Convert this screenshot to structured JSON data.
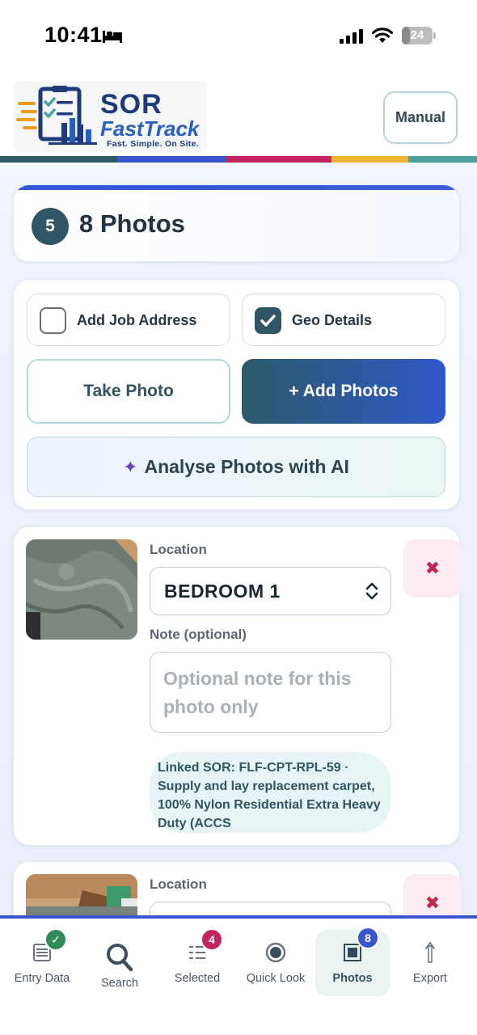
{
  "status_bar": {
    "time": "10:41",
    "battery_level": "24"
  },
  "header": {
    "logo": {
      "title": "SOR",
      "subtitle": "FastTrack",
      "tagline": "Fast. Simple. On Site."
    },
    "manual_label": "Manual",
    "strip_colors": [
      "#2f5a66",
      "#3a56cf",
      "#c2245e",
      "#f2b233",
      "#4ea19b"
    ]
  },
  "step": {
    "number": "5",
    "title": "8 Photos"
  },
  "options": {
    "add_job_address": {
      "label": "Add Job Address",
      "checked": false
    },
    "geo_details": {
      "label": "Geo Details",
      "checked": true
    }
  },
  "actions": {
    "take_photo": "Take Photo",
    "add_photos": "+ Add Photos",
    "analyse_ai": "Analyse Photos with AI"
  },
  "photos": [
    {
      "location_label": "Location",
      "location_value": "BEDROOM 1",
      "note_label": "Note (optional)",
      "note_placeholder": "Optional note for this photo only",
      "linked_sor": "Linked SOR: FLF-CPT-RPL-59 · Supply and lay replacement carpet, 100% Nylon Residential Extra Heavy Duty (ACCS",
      "remove_icon": "close-icon"
    },
    {
      "location_label": "Location",
      "remove_icon": "close-icon"
    }
  ],
  "bottom_nav": {
    "items": [
      {
        "label": "Entry Data",
        "icon": "document-icon",
        "badge": "✓",
        "badge_color": "#2f8a5a"
      },
      {
        "label": "Search",
        "icon": "search-icon"
      },
      {
        "label": "Selected",
        "icon": "list-icon",
        "badge": "4",
        "badge_color": "#c2245e"
      },
      {
        "label": "Quick Look",
        "icon": "record-icon"
      },
      {
        "label": "Photos",
        "icon": "photo-frame-icon",
        "badge": "8",
        "badge_color": "#3a56cf",
        "active": true
      },
      {
        "label": "Export",
        "icon": "export-arrow-icon"
      }
    ]
  }
}
